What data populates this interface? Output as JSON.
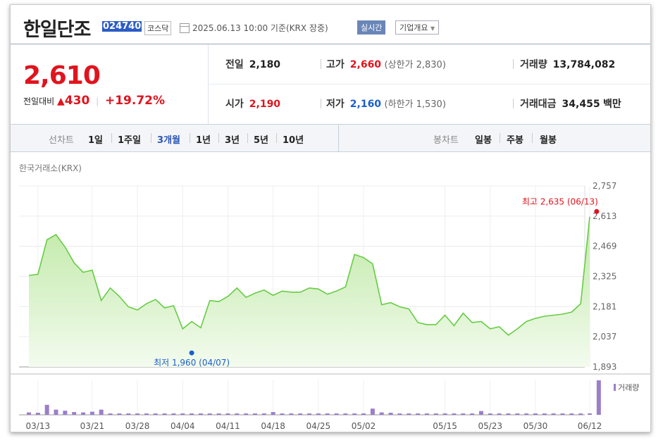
{
  "stock": {
    "name": "한일단조",
    "code": "024740",
    "market": "코스닥",
    "datetime": "2025.06.13 10:00 기준(KRX 장중)",
    "realtime_label": "실시간",
    "company_label": "기업개요",
    "current_price": "2,610",
    "change_label": "전일대비",
    "change_symbol": "▲",
    "change_value": "430",
    "change_pct": "+19.72%"
  },
  "stats": {
    "prev_close_label": "전일",
    "prev_close": "2,180",
    "high_label": "고가",
    "high": "2,660",
    "upper_limit": "(상한가 2,830)",
    "volume_label": "거래량",
    "volume": "13,784,082",
    "open_label": "시가",
    "open": "2,190",
    "low_label": "저가",
    "low": "2,160",
    "lower_limit": "(하한가 1,530)",
    "amount_label": "거래대금",
    "amount": "34,455",
    "amount_unit": "백만"
  },
  "periods": {
    "label": "선차트",
    "items": [
      "1일",
      "1주일",
      "3개월",
      "1년",
      "3년",
      "5년",
      "10년"
    ],
    "active": "3개월"
  },
  "candle": {
    "label": "봉차트",
    "items": [
      "일봉",
      "주봉",
      "월봉"
    ]
  },
  "source_label": "한국거래소(KRX)",
  "chart_data": {
    "type": "area",
    "x": [
      "03/12",
      "03/13",
      "03/14",
      "03/17",
      "03/18",
      "03/19",
      "03/20",
      "03/21",
      "03/24",
      "03/25",
      "03/26",
      "03/27",
      "03/28",
      "03/31",
      "04/01",
      "04/02",
      "04/03",
      "04/04",
      "04/07",
      "04/08",
      "04/09",
      "04/10",
      "04/11",
      "04/14",
      "04/15",
      "04/16",
      "04/17",
      "04/18",
      "04/21",
      "04/22",
      "04/23",
      "04/24",
      "04/25",
      "04/28",
      "04/29",
      "04/30",
      "05/01",
      "05/02",
      "05/07",
      "05/08",
      "05/09",
      "05/12",
      "05/13",
      "05/14",
      "05/15",
      "05/16",
      "05/19",
      "05/20",
      "05/21",
      "05/22",
      "05/23",
      "05/26",
      "05/27",
      "05/28",
      "05/29",
      "05/30",
      "06/02",
      "06/04",
      "06/05",
      "06/09",
      "06/10",
      "06/11",
      "06/12",
      "06/13"
    ],
    "values": [
      2330,
      2335,
      2500,
      2525,
      2465,
      2390,
      2345,
      2355,
      2210,
      2270,
      2230,
      2180,
      2165,
      2195,
      2215,
      2175,
      2185,
      2075,
      2110,
      2080,
      2210,
      2205,
      2230,
      2270,
      2225,
      2245,
      2260,
      2235,
      2255,
      2250,
      2250,
      2270,
      2265,
      2240,
      2255,
      2275,
      2430,
      2415,
      2385,
      2190,
      2200,
      2180,
      2170,
      2105,
      2095,
      2095,
      2140,
      2090,
      2150,
      2105,
      2110,
      2075,
      2085,
      2045,
      2075,
      2110,
      2125,
      2135,
      2140,
      2145,
      2155,
      2195,
      2610
    ],
    "volumes": [
      0.07,
      0.06,
      0.29,
      0.15,
      0.12,
      0.08,
      0.07,
      0.09,
      0.15,
      0.04,
      0.04,
      0.04,
      0.04,
      0.04,
      0.04,
      0.04,
      0.04,
      0.04,
      0.04,
      0.04,
      0.04,
      0.04,
      0.03,
      0.04,
      0.03,
      0.03,
      0.03,
      0.08,
      0.04,
      0.04,
      0.03,
      0.03,
      0.03,
      0.03,
      0.03,
      0.03,
      0.03,
      0.03,
      0.18,
      0.07,
      0.06,
      0.04,
      0.04,
      0.03,
      0.03,
      0.03,
      0.04,
      0.03,
      0.04,
      0.04,
      0.11,
      0.04,
      0.04,
      0.03,
      0.04,
      0.03,
      0.03,
      0.03,
      0.03,
      0.03,
      0.04,
      0.04,
      0.03,
      1.0
    ],
    "y_ticks": [
      "2,757",
      "2,613",
      "2,469",
      "2,325",
      "2,181",
      "2,037",
      "1,893"
    ],
    "ylim": [
      1893,
      2757
    ],
    "x_ticks": [
      "03/13",
      "03/21",
      "03/28",
      "04/04",
      "04/11",
      "04/18",
      "04/25",
      "05/02",
      "05/15",
      "05/23",
      "05/30",
      "06/12"
    ],
    "x_tick_index": [
      1,
      7,
      12,
      17,
      22,
      27,
      32,
      37,
      46,
      51,
      56,
      62
    ],
    "high": {
      "label": "최고 2,635 (06/13)",
      "value": 2635,
      "index": 63
    },
    "low": {
      "label": "최저 1,960 (04/07)",
      "value": 1960,
      "index": 18
    },
    "volume_legend": "거래량",
    "colors": {
      "line": "#66cc44",
      "fill_top": "#bfe9a6",
      "fill_bottom": "#f3fbee",
      "volume": "#9b7fc9",
      "high": "#e0141e",
      "low": "#1a5fc9"
    }
  }
}
